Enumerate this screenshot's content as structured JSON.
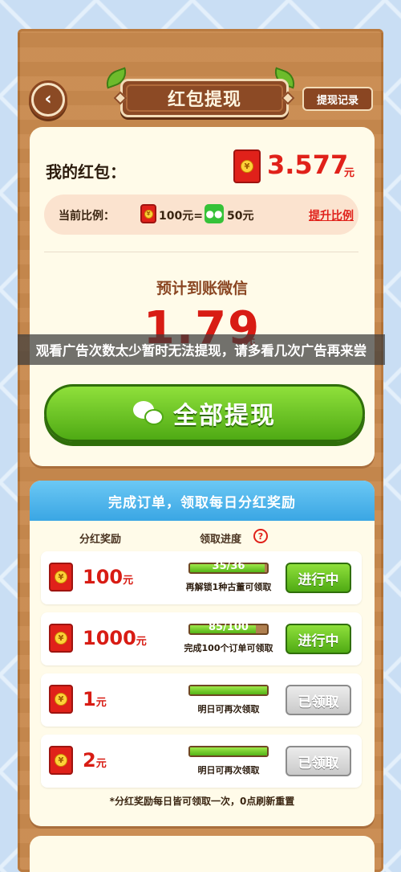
{
  "header": {
    "title": "红包提现",
    "record_label": "提现记录"
  },
  "wallet": {
    "label": "我的红包：",
    "balance": "3.577",
    "balance_unit": "元",
    "ratio_label": "当前比例：",
    "ratio_hb": "100元=",
    "ratio_wx": "50元",
    "upgrade_label": "提升比例"
  },
  "withdraw": {
    "expect_label": "预计到账微信",
    "amount": "1.79",
    "amount_unit": "元",
    "button_label": "全部提现"
  },
  "toast": "观看广告次数太少暂时无法提现，请多看几次广告再来尝",
  "bonus": {
    "title": "完成订单，领取每日分红奖励",
    "col_reward": "分红奖励",
    "col_progress": "领取进度",
    "help": "?",
    "rows": [
      {
        "amount": "100",
        "unit": "元",
        "progress_text": "35/36",
        "progress": 0.97,
        "desc": "再解锁1种古董可领取",
        "state": "进行中"
      },
      {
        "amount": "1000",
        "unit": "元",
        "progress_text": "85/100",
        "progress": 0.85,
        "desc": "完成100个订单可领取",
        "state": "进行中"
      },
      {
        "amount": "1",
        "unit": "元",
        "progress_text": "",
        "progress": 1.0,
        "desc": "明日可再次领取",
        "state": "已领取"
      },
      {
        "amount": "2",
        "unit": "元",
        "progress_text": "",
        "progress": 1.0,
        "desc": "明日可再次领取",
        "state": "已领取"
      }
    ],
    "footnote": "*分红奖励每日皆可领取一次，0点刷新重置"
  },
  "colors": {
    "accent_red": "#d81c14",
    "accent_green": "#4faa14",
    "wood": "#c98a4e",
    "sky": "#3aa6e4"
  }
}
